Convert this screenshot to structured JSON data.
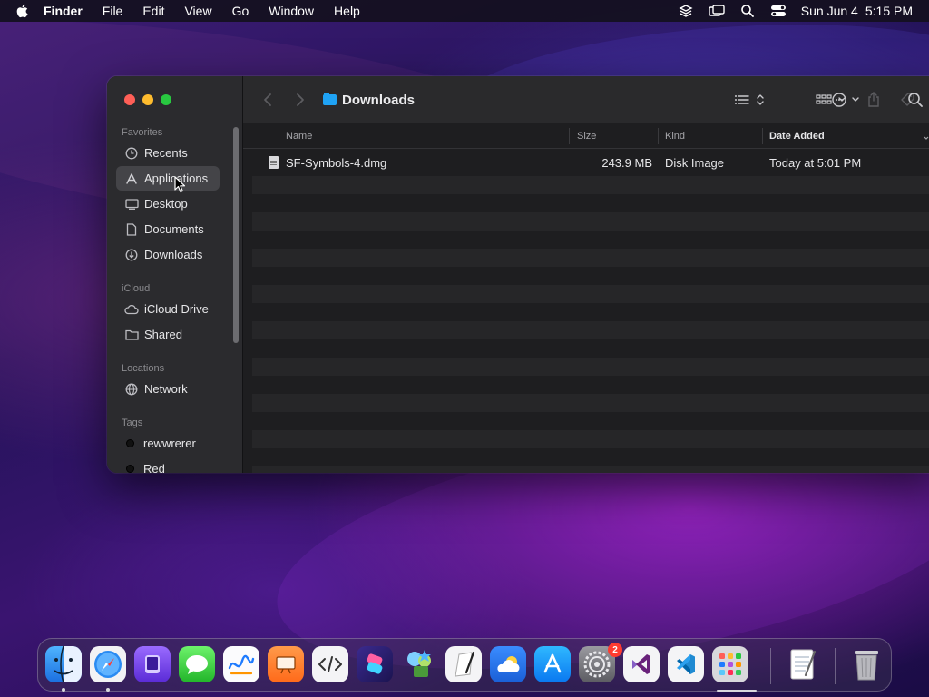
{
  "menubar": {
    "apple_icon": "apple-logo",
    "app_name": "Finder",
    "menus": [
      "File",
      "Edit",
      "View",
      "Go",
      "Window",
      "Help"
    ],
    "status_icons": [
      "stack-icon",
      "screen-mirroring-icon",
      "spotlight-search-icon",
      "control-center-icon"
    ],
    "date": "Sun Jun 4",
    "time": "5:15 PM"
  },
  "window": {
    "title": "Downloads",
    "sidebar": {
      "sections": [
        {
          "title": "Favorites",
          "items": [
            {
              "label": "Recents",
              "icon": "clock-icon"
            },
            {
              "label": "Applications",
              "icon": "applications-icon",
              "selected": true
            },
            {
              "label": "Desktop",
              "icon": "desktop-icon"
            },
            {
              "label": "Documents",
              "icon": "document-icon"
            },
            {
              "label": "Downloads",
              "icon": "download-icon"
            }
          ]
        },
        {
          "title": "iCloud",
          "items": [
            {
              "label": "iCloud Drive",
              "icon": "cloud-icon"
            },
            {
              "label": "Shared",
              "icon": "shared-folder-icon"
            }
          ]
        },
        {
          "title": "Locations",
          "items": [
            {
              "label": "Network",
              "icon": "network-icon"
            }
          ]
        },
        {
          "title": "Tags",
          "items": [
            {
              "label": "rewwrerer",
              "icon": "tag-dot"
            },
            {
              "label": "Red",
              "icon": "tag-dot"
            }
          ]
        }
      ]
    },
    "toolbar": {
      "icons": [
        "back-icon",
        "forward-icon",
        "list-view-icon",
        "group-icon",
        "share-icon",
        "tag-icon",
        "more-icon",
        "search-icon"
      ]
    },
    "columns": [
      "Name",
      "Size",
      "Kind",
      "Date Added"
    ],
    "files": [
      {
        "name": "SF-Symbols-4.dmg",
        "size": "243.9 MB",
        "kind": "Disk Image",
        "date_added": "Today at 5:01 PM"
      }
    ]
  },
  "dock": {
    "apps": [
      "Finder",
      "Safari",
      "Simulator",
      "Messages",
      "Freeform",
      "Keynote",
      "Script Editor",
      "Shortcuts",
      "Keychain Access",
      "Script Editor",
      "Weather",
      "App Store",
      "System Settings",
      "Visual Studio",
      "Visual Studio Code",
      "Launchpad",
      "TextEdit",
      "Trash"
    ],
    "system_settings_badge": "2"
  }
}
